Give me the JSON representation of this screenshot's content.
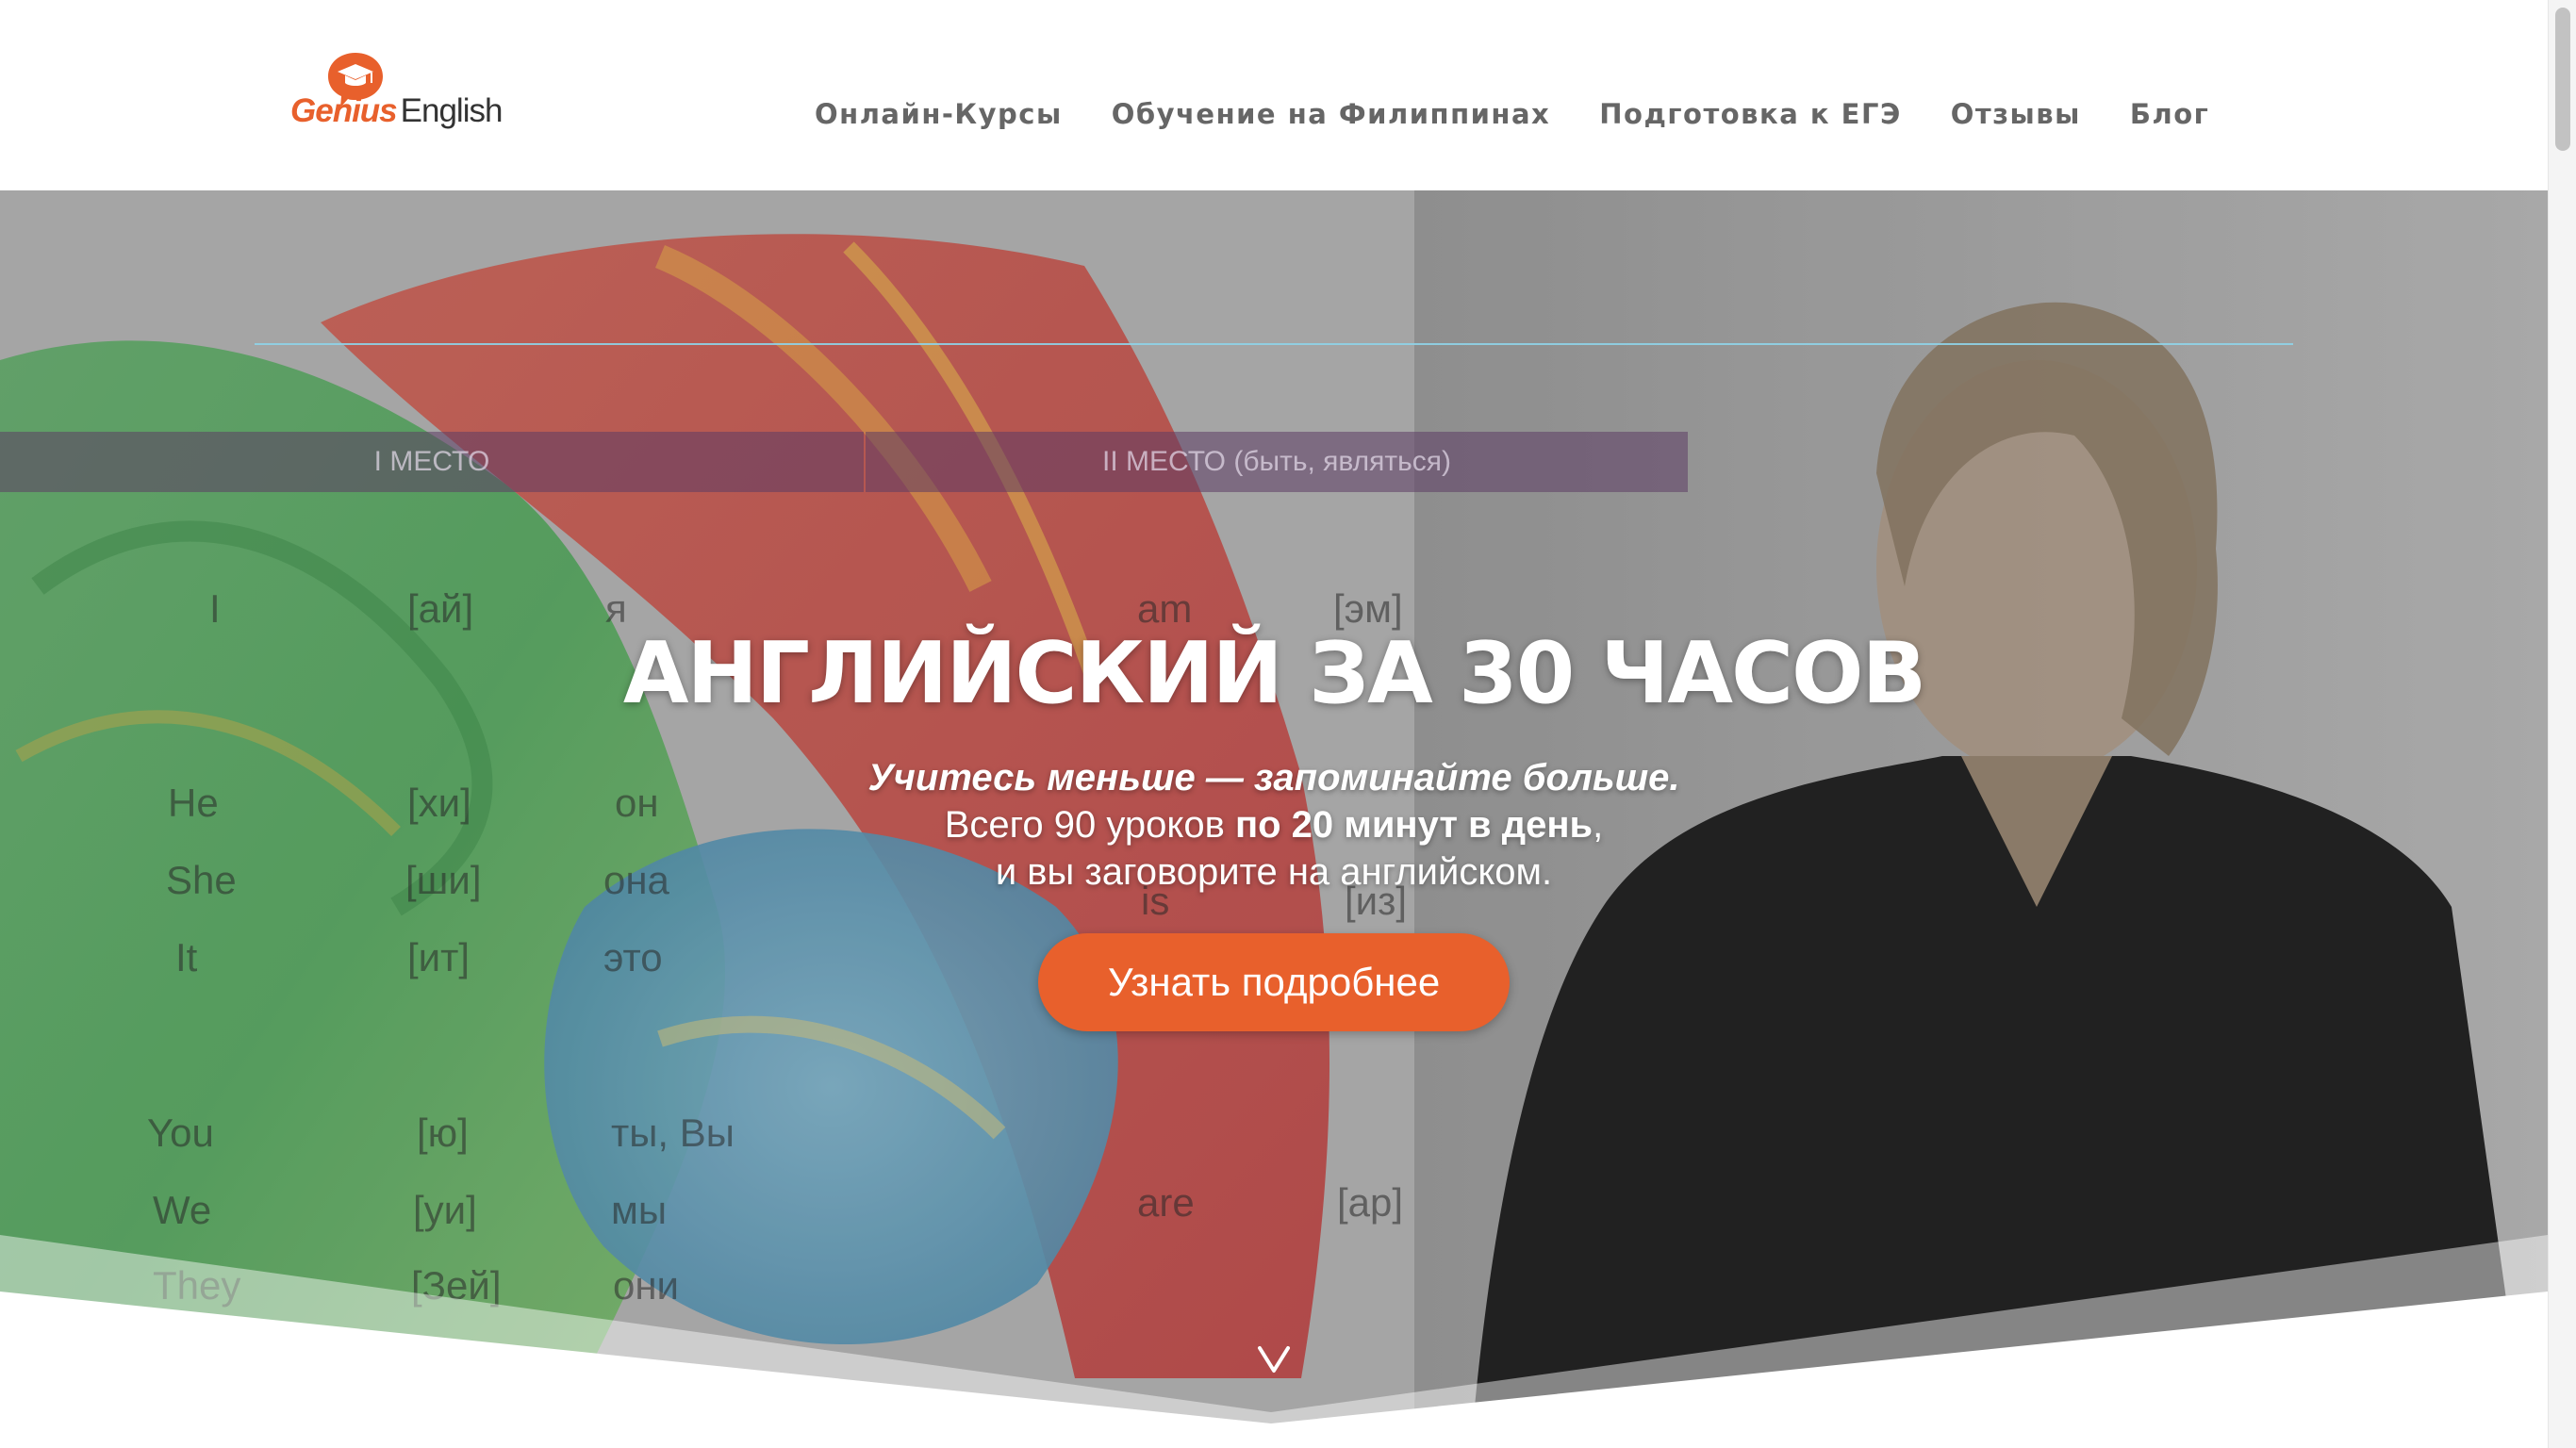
{
  "header": {
    "logo": {
      "genius": "Genius",
      "english": "English"
    },
    "nav": [
      {
        "label": "Онлайн-Курсы"
      },
      {
        "label": "Обучение на Филиппинах"
      },
      {
        "label": "Подготовка к ЕГЭ"
      },
      {
        "label": "Отзывы"
      },
      {
        "label": "Блог"
      }
    ]
  },
  "hero": {
    "title": "АНГЛИЙСКИЙ ЗА 30 ЧАСОВ",
    "subtitle_line1": "Учитесь меньше — запоминайте больше.",
    "subtitle_line2_start": "Всего 90 уроков ",
    "subtitle_line2_bold": "по 20 минут в день",
    "subtitle_line2_end": ",",
    "subtitle_line3": "и вы заговорите на английском.",
    "cta_label": "Узнать подробнее",
    "board": {
      "head_left": "I МЕСТО",
      "head_right": "II МЕСТО (быть, являться)",
      "words": [
        "I",
        "[ай]",
        "я",
        "am",
        "[эм]",
        "He",
        "[хи]",
        "он",
        "She",
        "[ши]",
        "она",
        "is",
        "[из]",
        "It",
        "[ит]",
        "это",
        "You",
        "[ю]",
        "ты, Вы",
        "We",
        "[уи]",
        "мы",
        "are",
        "[ар]",
        "They",
        "[Зей]",
        "они"
      ]
    }
  },
  "colors": {
    "accent": "#e8602c",
    "nav_text": "#666666",
    "rule": "#8fd3e8"
  },
  "icons": {
    "logo": "graduation-cap-bubble-icon",
    "scroll_down": "chevron-down-icon"
  }
}
